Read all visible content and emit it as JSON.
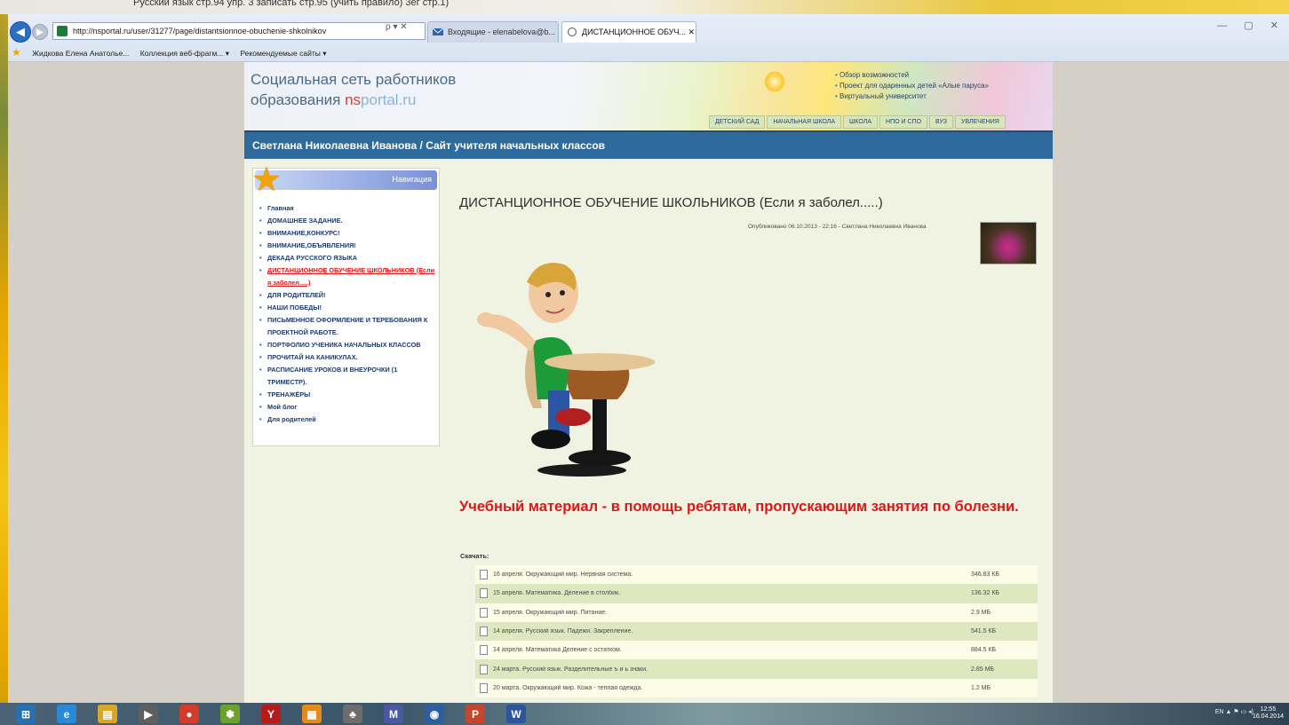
{
  "desktop": {
    "top_text": "Русский язык  стр.94 упр. 3 записать стр.95 (учить правило) 3ег стр.1)"
  },
  "browser": {
    "url": "http://nsportal.ru/user/31277/page/distantsionnoe-obuchenie-shkolnikov",
    "addr_controls": "ρ ▾ ✕",
    "tabs": [
      {
        "label": "Входящие - elenabelova@b..."
      },
      {
        "label": "ДИСТАНЦИОННОЕ ОБУЧ... ✕"
      }
    ],
    "window_controls": "— ▢ ✕",
    "favorites": [
      "Жидкова Елена Анатолье...",
      "Коллекция веб-фрагм... ▾",
      "Рекомендуемые сайты ▾"
    ]
  },
  "site": {
    "logo_line1": "Социальная сеть работников",
    "logo_line2_prefix": "образования ",
    "logo_ns": "ns",
    "logo_portal": "portal.ru",
    "header_links": [
      "Обзор возможностей",
      "Проект для одаренных детей «Алые паруса»",
      "Виртуальный университет"
    ],
    "header_nav": [
      "ДЕТСКИЙ САД",
      "НАЧАЛЬНАЯ ШКОЛА",
      "ШКОЛА",
      "НПО И СПО",
      "ВУЗ",
      "УВЛЕЧЕНИЯ"
    ],
    "user_bar": "Светлана Николаевна Иванова / Сайт учителя начальных классов"
  },
  "sidebar": {
    "heading": "Навигация",
    "items": [
      {
        "label": "Главная"
      },
      {
        "label": "ДОМАШНЕЕ ЗАДАНИЕ."
      },
      {
        "label": "ВНИМАНИЕ,КОНКУРС!"
      },
      {
        "label": "ВНИМАНИЕ,ОБЪЯВЛЕНИЯ!"
      },
      {
        "label": "ДЕКАДА РУССКОГО ЯЗЫКА"
      },
      {
        "label": "ДИСТАНЦИОННОЕ ОБУЧЕНИЕ ШКОЛЬНИКОВ (Если я заболел.....)"
      },
      {
        "label": "ДЛЯ РОДИТЕЛЕЙ!"
      },
      {
        "label": "НАШИ ПОБЕДЫ!"
      },
      {
        "label": "ПИСЬМЕННОЕ ОФОРМЛЕНИЕ И ТЕРЕБОВАНИЯ К ПРОЕКТНОЙ РАБОТЕ."
      },
      {
        "label": "ПОРТФОЛИО УЧЕНИКА НАЧАЛЬНЫХ КЛАССОВ"
      },
      {
        "label": "ПРОЧИТАЙ НА КАНИКУЛАХ."
      },
      {
        "label": "РАСПИСАНИЕ УРОКОВ И ВНЕУРОЧКИ (1 ТРИМЕСТР)."
      },
      {
        "label": "ТРЕНАЖЁРЫ"
      },
      {
        "label": "Мой блог"
      },
      {
        "label": "Для родителей"
      }
    ]
  },
  "content": {
    "title": "ДИСТАНЦИОННОЕ ОБУЧЕНИЕ ШКОЛЬНИКОВ (Если я заболел.....)",
    "published": "Опубликовано 06.10.2013 - 22:16 - Светлана Николаевна Иванова",
    "headline": "Учебный материал - в помощь ребятам, пропускающим занятия по болезни.",
    "downloads_label": "Скачать:",
    "files": [
      {
        "name": "16 апреля. Окружающий мир. Нервная система.",
        "size": "346.83 КБ"
      },
      {
        "name": "15 апреля. Математика. Деление в столбик.",
        "size": "136.32 КБ"
      },
      {
        "name": "15 апреля. Окружающий мир. Питание.",
        "size": "2.9 МБ"
      },
      {
        "name": "14 апреля. Русский язык. Падежи. Закрепление.",
        "size": "541.5 КБ"
      },
      {
        "name": "14 апреля. Математика Деление с остатком.",
        "size": "884.5 КБ"
      },
      {
        "name": "24 марта. Русский язык. Разделительные ъ и ь знаки.",
        "size": "2.85 МБ"
      },
      {
        "name": "20 марта. Окружающий мир. Кожа - теплая одежда.",
        "size": "1.2 МБ"
      }
    ]
  },
  "taskbar": {
    "tray": "EN  ▲ ⚑ ▭ ◂)",
    "time": "12:55",
    "date": "16.04.2014",
    "apps": [
      {
        "glyph": "⊞",
        "color": "#2a6fb0"
      },
      {
        "glyph": "e",
        "color": "#2a8ad8"
      },
      {
        "glyph": "▤",
        "color": "#d7a72a"
      },
      {
        "glyph": "▶",
        "color": "#5f5f5f"
      },
      {
        "glyph": "●",
        "color": "#d33b2c"
      },
      {
        "glyph": "✽",
        "color": "#6aa22d"
      },
      {
        "glyph": "Y",
        "color": "#b51b1b"
      },
      {
        "glyph": "▦",
        "color": "#e58a1c"
      },
      {
        "glyph": "♣",
        "color": "#6d6d6d"
      },
      {
        "glyph": "M",
        "color": "#4b5aa0"
      },
      {
        "glyph": "◉",
        "color": "#2d5f9c"
      },
      {
        "glyph": "P",
        "color": "#c4472d"
      },
      {
        "glyph": "W",
        "color": "#2b579a"
      }
    ]
  }
}
